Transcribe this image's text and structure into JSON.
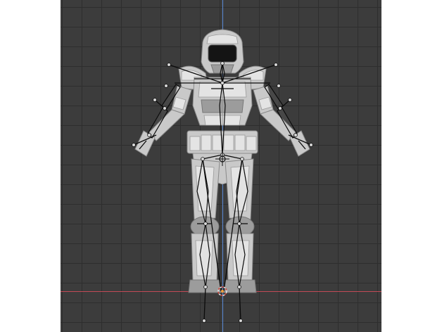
{
  "viewport": {
    "background": "#3c3c3c",
    "grid_color": "#2e2e2e",
    "x_axis_color": "#c14a56",
    "y_axis_color": "#5a8ad6"
  },
  "scene": {
    "object": "armored-figure-mesh",
    "rig": "armature-bones",
    "origin_marker": "3d-cursor-icon"
  }
}
